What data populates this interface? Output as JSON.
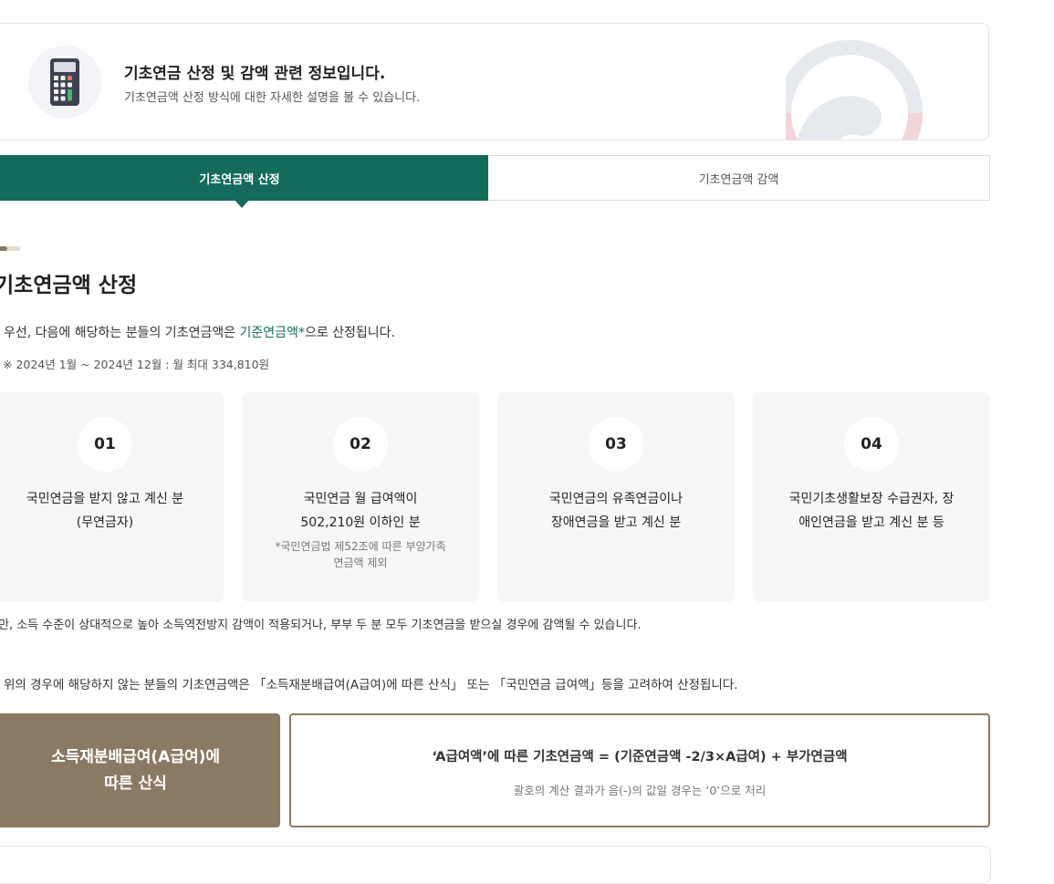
{
  "info": {
    "title": "기초연금 산정 및 감액 관련 정보입니다.",
    "subtitle": "기초연금액 산정 방식에 대한 자세한 설명을 볼 수 있습니다."
  },
  "tabs": [
    {
      "label": "기초연금액 산정",
      "active": true
    },
    {
      "label": "기초연금액 감액",
      "active": false
    }
  ],
  "section": {
    "title": "기초연금액 산정",
    "intro_prefix": "우선, 다음에 해당하는 분들의 기초연금액은 ",
    "intro_highlight": "기준연금액*",
    "intro_suffix": "으로 산정됩니다.",
    "intro_note": "※ 2024년 1월 ~ 2024년 12월 : 월 최대 334,810원"
  },
  "cards": [
    {
      "num": "01",
      "line1": "국민연금을 받지 않고 계신 분",
      "line2": "(무연금자)",
      "note1": "",
      "note2": ""
    },
    {
      "num": "02",
      "line1": "국민연금 월 급여액이",
      "line2": "502,210원 이하인 분",
      "note1": "*국민연금법 제52조에 따른 부양가족",
      "note2": "연금액 제외"
    },
    {
      "num": "03",
      "line1": "국민연금의 유족연금이나",
      "line2": "장애연금을 받고 계신 분",
      "note1": "",
      "note2": ""
    },
    {
      "num": "04",
      "line1": "국민기초생활보장 수급권자, 장",
      "line2": "애인연금을 받고 계신 분 등",
      "note1": "",
      "note2": ""
    }
  ],
  "reduction_note": "만, 소득 수준이 상대적으로 높아 소득역전방지 감액이 적용되거나, 부부 두 분 모두 기초연금을 받으실 경우에 감액될 수 있습니다.",
  "other_case": "위의 경우에 해당하지 않는 분들의 기초연금액은 「소득재분배급여(A급여)에 따른 산식」 또는 「국민연금 급여액」등을 고려하여 산정됩니다.",
  "formula": {
    "label_line1": "소득재분배급여(A급여)에",
    "label_line2": "따른 산식",
    "main": "‘A급여액’에 따른 기초연금액 = (기준연금액 -2/3×A급여) + 부가연금액",
    "note": "괄호의 계산 결과가 음(-)의 값일 경우는 ‘0’으로 처리"
  },
  "colors": {
    "primary_green": "#146b5a",
    "brown": "#8b7a63",
    "card_bg": "#f6f7f9"
  },
  "icons": {
    "calculator": "calculator-icon",
    "emblem": "government-emblem-icon"
  }
}
